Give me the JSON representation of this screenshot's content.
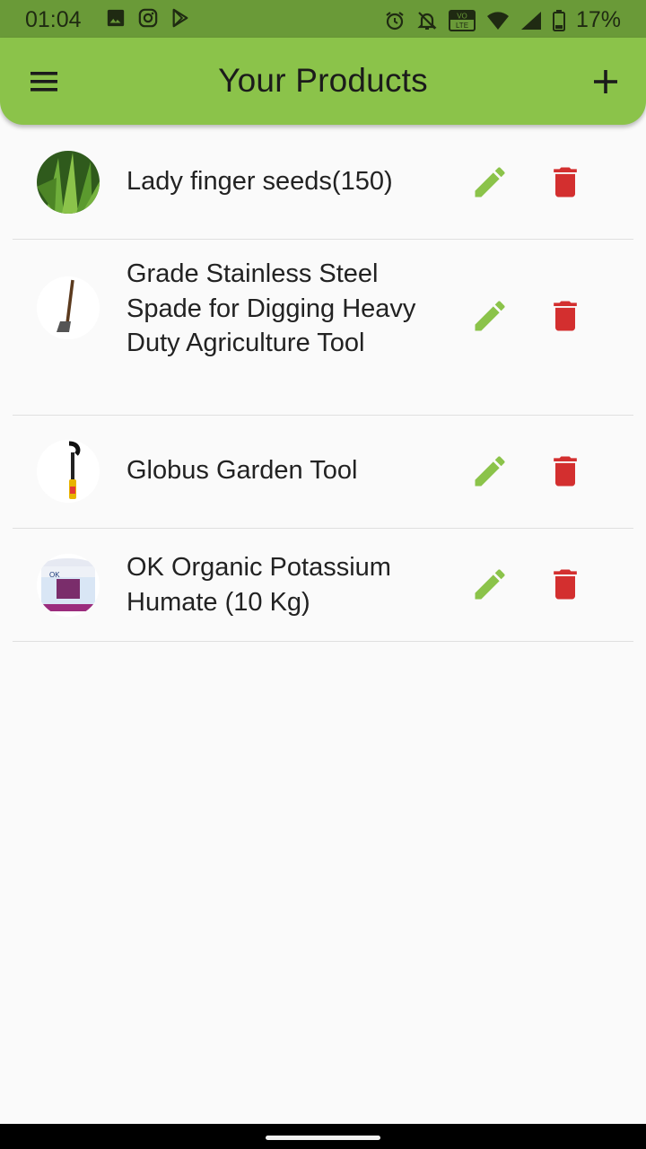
{
  "status_bar": {
    "time": "01:04",
    "battery": "17%",
    "left_icons": [
      "image-icon",
      "instagram-icon",
      "play-store-icon"
    ],
    "right_icons": [
      "alarm-icon",
      "notifications-off-icon",
      "volte-icon",
      "wifi-icon",
      "signal-icon",
      "battery-icon"
    ],
    "volte_label": "VO\nLTE"
  },
  "app_bar": {
    "title": "Your Products",
    "background": "#8bc34a",
    "menu_icon": "menu-icon",
    "add_icon": "add-icon"
  },
  "products": [
    {
      "name": "Lady finger seeds(150)",
      "image": "lady-finger-plant"
    },
    {
      "name": "Grade Stainless Steel Spade for Digging Heavy Duty Agriculture Tool",
      "image": "spade"
    },
    {
      "name": "Globus Garden Tool",
      "image": "garden-tool"
    },
    {
      "name": "OK Organic Potassium Humate (10 Kg)",
      "image": "potassium-humate-bucket"
    }
  ],
  "row_actions": {
    "edit_icon": "edit-icon",
    "delete_icon": "delete-icon",
    "edit_color": "#8bc34a",
    "delete_color": "#d32f2f"
  }
}
